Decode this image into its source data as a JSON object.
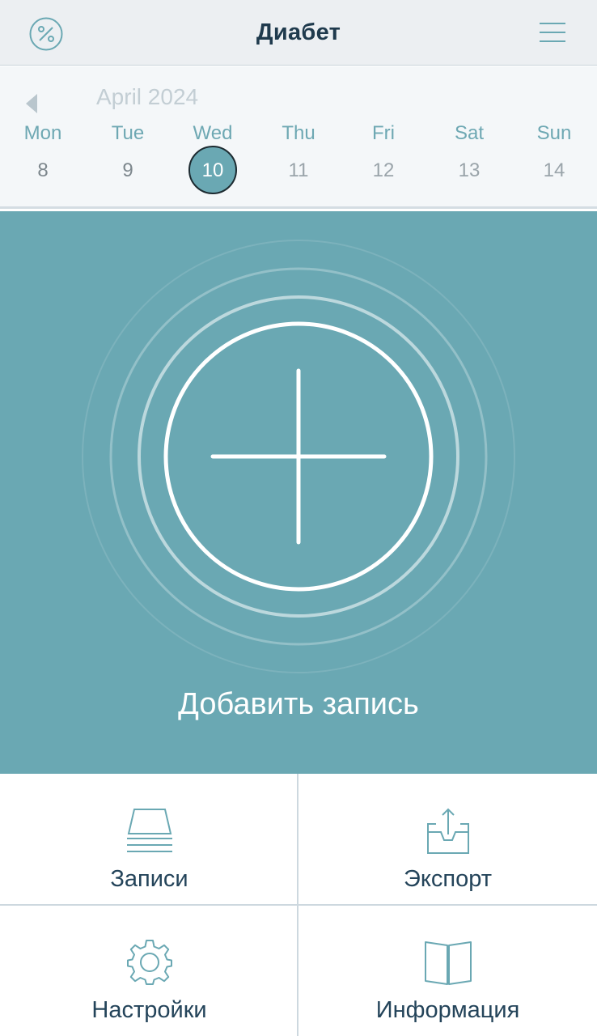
{
  "header": {
    "title": "Диабет",
    "left_icon": "percent-icon",
    "right_icon": "hamburger-menu-icon"
  },
  "calendar": {
    "month": "April 2024",
    "prev_icon": "triangle-left-icon",
    "days": [
      {
        "dow": "Mon",
        "num": "8"
      },
      {
        "dow": "Tue",
        "num": "9"
      },
      {
        "dow": "Wed",
        "num": "10",
        "selected": true
      },
      {
        "dow": "Thu",
        "num": "11"
      },
      {
        "dow": "Fri",
        "num": "12"
      },
      {
        "dow": "Sat",
        "num": "13"
      },
      {
        "dow": "Sun",
        "num": "14"
      }
    ]
  },
  "main": {
    "add_label": "Добавить запись",
    "add_icon": "plus-icon"
  },
  "grid": {
    "records_label": "Записи",
    "export_label": "Экспорт",
    "settings_label": "Настройки",
    "info_label": "Информация"
  },
  "colors": {
    "teal": "#6aa8b3",
    "header_bg": "#eceff2",
    "title": "#1f3a4d",
    "label": "#24445a"
  }
}
